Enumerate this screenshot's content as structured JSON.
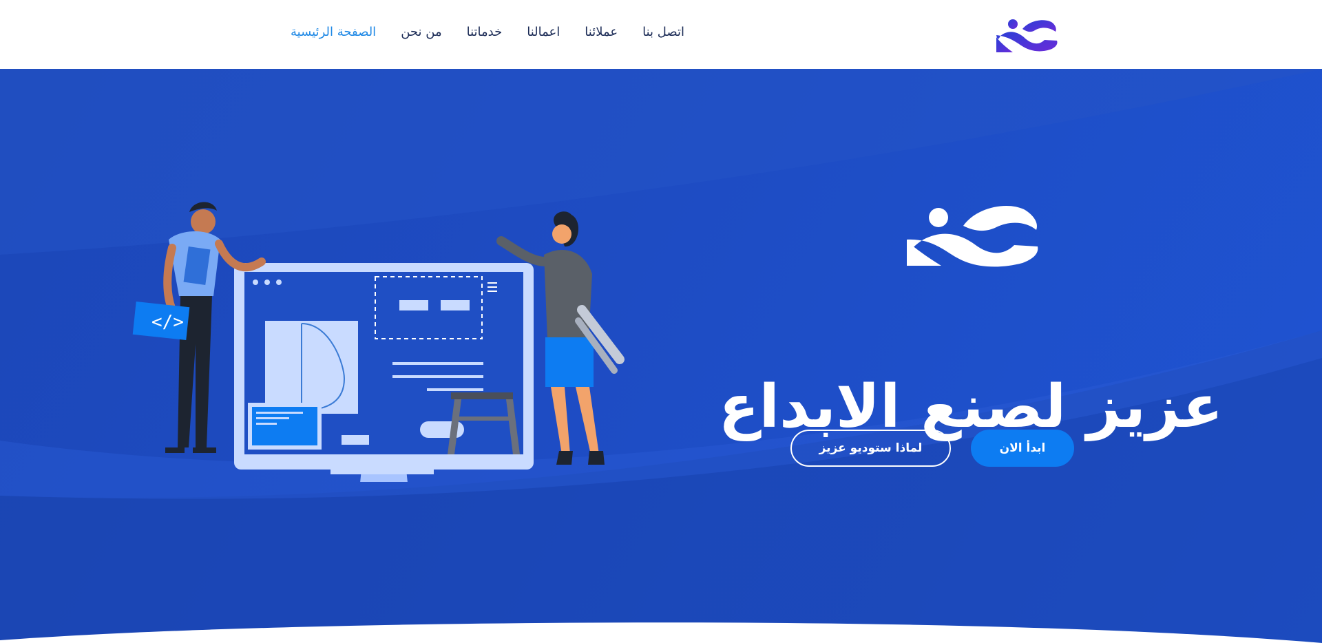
{
  "colors": {
    "header_bg": "#ffffff",
    "hero_bg": "#1e4cc3",
    "nav_text": "#1a2a55",
    "nav_active": "#1e88e5",
    "primary_button": "#0d7cf2",
    "logo_gradient_start": "#2b3fd6",
    "logo_gradient_end": "#6a2bd9"
  },
  "header": {
    "logo_icon": "brand-logo",
    "nav": {
      "home": "الصفحة الرئيسية",
      "about": "من نحن",
      "services": "خدماتنا",
      "works": "اعمالنا",
      "clients": "عملائنا",
      "contact": "اتصل بنا"
    },
    "active_item": "home"
  },
  "hero": {
    "title": "عزيز لصنع الابداع",
    "primary_button": "ابدأ الان",
    "secondary_button": "لماذا ستوديو عزيز",
    "illustration": "designers-working-on-monitor"
  }
}
